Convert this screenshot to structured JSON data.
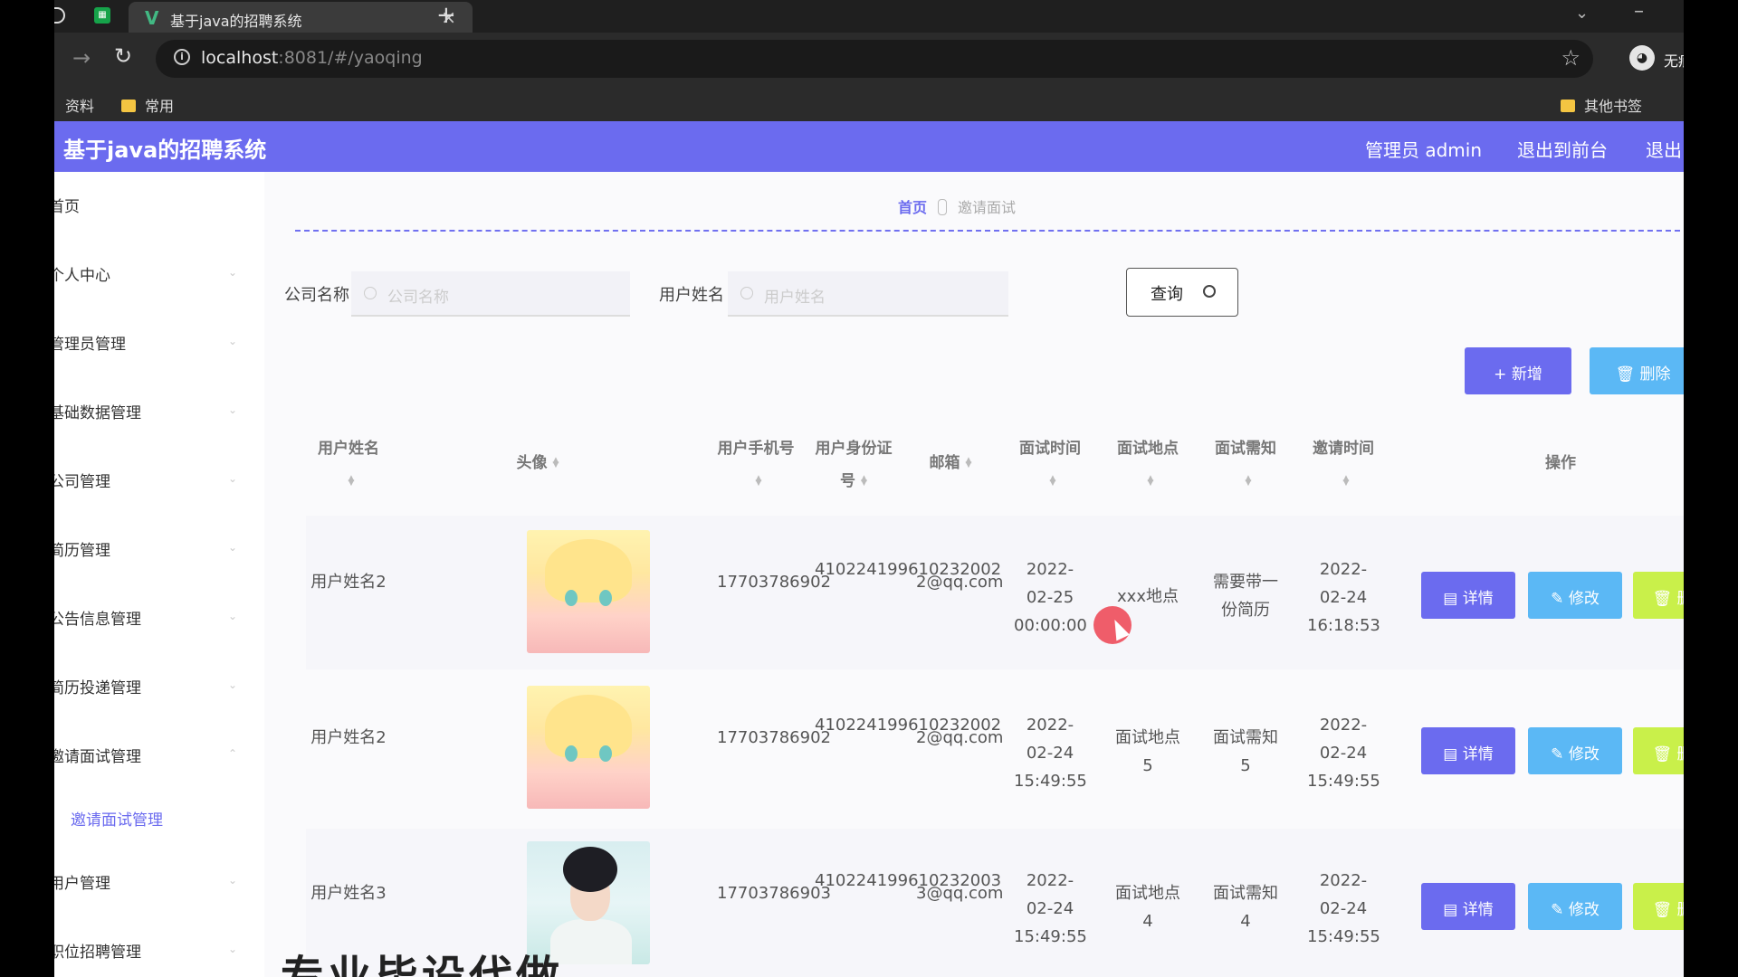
{
  "browser": {
    "tab_title": "基于java的招聘系统",
    "tab_logo": "V",
    "tab_close": "×",
    "new_tab": "+",
    "url_host": "localhost",
    "url_rest": ":8081/#/yaoqing",
    "incognito_label": "无痕模式",
    "bookmarks": [
      "资料",
      "常用"
    ],
    "other_bookmarks": "其他书签"
  },
  "header": {
    "title": "基于java的招聘系统",
    "admin": "管理员 admin",
    "to_front": "退出到前台",
    "logout": "退出"
  },
  "sidebar": {
    "items": [
      "首页",
      "个人中心",
      "管理员管理",
      "基础数据管理",
      "公司管理",
      "简历管理",
      "公告信息管理",
      "简历投递管理",
      "邀请面试管理"
    ],
    "sub_item": "邀请面试管理",
    "items_after": [
      "用户管理",
      "职位招聘管理"
    ]
  },
  "breadcrumb": {
    "home": "首页",
    "current": "邀请面试"
  },
  "search": {
    "company_label": "公司名称",
    "company_placeholder": "公司名称",
    "user_label": "用户姓名",
    "user_placeholder": "用户姓名",
    "query_button": "查询"
  },
  "actions": {
    "add": "+ 新增",
    "delete": "删除"
  },
  "table": {
    "headers": [
      "用户姓名",
      "头像",
      "用户手机号",
      "用户身份证号",
      "邮箱",
      "面试时间",
      "面试地点",
      "面试需知",
      "邀请时间",
      "操作"
    ],
    "rows": [
      {
        "name": "用户姓名2",
        "avatar": "anime-girl",
        "phone": "17703786902",
        "idcard": "410224199610232002",
        "email": "2@qq.com",
        "interview_time": "2022-02-25 00:00:00",
        "place": "xxx地点",
        "notice": "需要带一份简历",
        "invite_time": "2022-02-24 16:18:53"
      },
      {
        "name": "用户姓名2",
        "avatar": "anime-girl",
        "phone": "17703786902",
        "idcard": "410224199610232002",
        "email": "2@qq.com",
        "interview_time": "2022-02-24 15:49:55",
        "place": "面试地点5",
        "notice": "面试需知5",
        "invite_time": "2022-02-24 15:49:55"
      },
      {
        "name": "用户姓名3",
        "avatar": "woman-photo",
        "phone": "17703786903",
        "idcard": "410224199610232003",
        "email": "3@qq.com",
        "interview_time": "2022-02-24 15:49:55",
        "place": "面试地点4",
        "notice": "面试需知4",
        "invite_time": "2022-02-24 15:49:55"
      }
    ],
    "row_actions": {
      "detail": "详情",
      "edit": "修改",
      "delete": "删除"
    }
  },
  "caption": "专业毕设代做",
  "colors": {
    "primary": "#6b6bef",
    "info": "#5bb8f5",
    "lime": "#c9f04a"
  }
}
